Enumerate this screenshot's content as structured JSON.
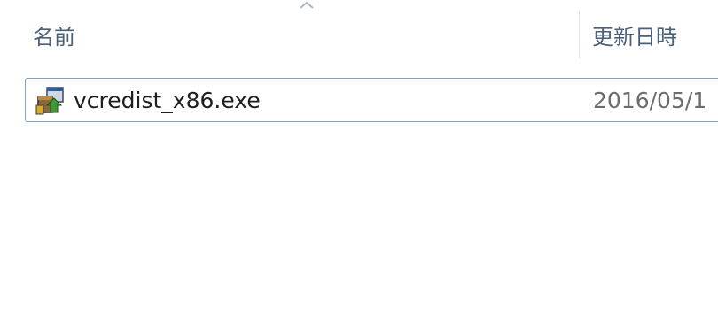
{
  "columns": {
    "name_label": "名前",
    "date_label": "更新日時",
    "sort_indicator": "ascending"
  },
  "files": [
    {
      "name": "vcredist_x86.exe",
      "modified": "2016/05/1",
      "icon": "installer-icon"
    }
  ],
  "colors": {
    "header_text": "#4c607a",
    "selection_border": "#7da2ce",
    "date_text": "#6d6d6d"
  }
}
